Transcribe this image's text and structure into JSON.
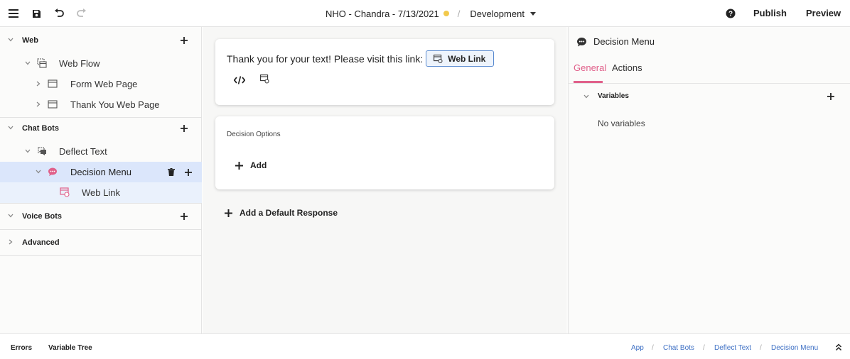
{
  "header": {
    "project_title": "NHO - Chandra - 7/13/2021",
    "environment": "Development",
    "publish_label": "Publish",
    "preview_label": "Preview",
    "status_color": "#f2c94c"
  },
  "sidebar": {
    "sections": {
      "web": "Web",
      "chat_bots": "Chat Bots",
      "voice_bots": "Voice Bots",
      "advanced": "Advanced"
    },
    "items": {
      "web_flow": "Web Flow",
      "form_web_page": "Form Web Page",
      "thank_you_web_page": "Thank You Web Page",
      "deflect_text": "Deflect Text",
      "decision_menu": "Decision Menu",
      "web_link": "Web Link"
    },
    "selected_color": "#dbe6fb"
  },
  "canvas": {
    "message_text": "Thank you for your text! Please visit this link:",
    "message_chip": "Web Link",
    "decision_options_label": "Decision Options",
    "add_label": "Add",
    "add_default_label": "Add a Default Response"
  },
  "panel": {
    "title": "Decision Menu",
    "tabs": [
      "General",
      "Actions"
    ],
    "active_tab_color": "#e0608a",
    "variables_label": "Variables",
    "no_variables": "No variables"
  },
  "footer": {
    "errors_label": "Errors",
    "variable_tree_label": "Variable Tree",
    "breadcrumb": [
      "App",
      "Chat Bots",
      "Deflect Text",
      "Decision Menu"
    ],
    "link_color": "#3d6fc4"
  }
}
